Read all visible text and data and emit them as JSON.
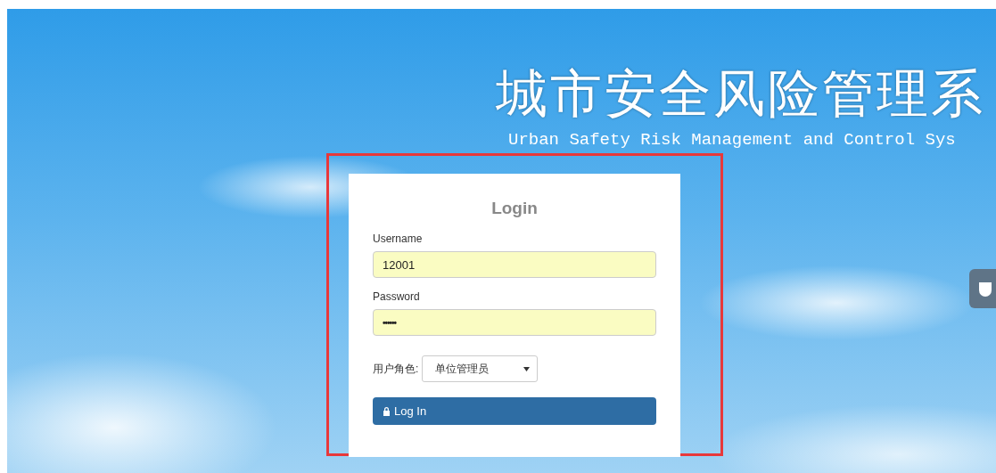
{
  "header": {
    "title": "城市安全风险管理系",
    "subtitle": "Urban Safety Risk Management and Control Sys"
  },
  "login": {
    "heading": "Login",
    "fields": [
      {
        "kind": "text",
        "label": "Username",
        "value": "12001"
      },
      {
        "kind": "password",
        "label": "Password",
        "value": "••••••"
      }
    ],
    "role": {
      "label": "用户角色:",
      "value": "单位管理员"
    },
    "button": "Log In"
  }
}
